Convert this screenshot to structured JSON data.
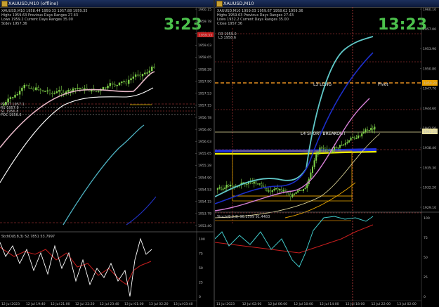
{
  "left": {
    "title": "XAUUSD,M10 (offline)",
    "header": [
      "XAUUSD,M10  1958.44 1959.33 1957.88 1959.35",
      "Highs 1959.63   Previous Days Ranges 27.43",
      "Lows 1959.2    Current Days Ranges 35.00",
      "Stdev 1957.36"
    ],
    "clock": "3:23",
    "price_labels": [
      "1960.15",
      "1959.78",
      "1959.40",
      "1959.03",
      "1958.65",
      "1958.28",
      "1957.90",
      "1957.53",
      "1957.15",
      "1956.78",
      "1956.40",
      "1956.03",
      "1955.65",
      "1955.28",
      "1954.90",
      "1954.53",
      "1954.15",
      "1953.78",
      "1953.40"
    ],
    "current_price": "1959.33",
    "mini_labels": [
      "PIVOT 1957.1",
      "R1 1957.0",
      "S1 1956.8",
      "POC 1956.6"
    ],
    "indicator_header": "StchD(8,8,3) 52.7851 53.7997",
    "indicator_levels": [
      "100",
      "75",
      "50",
      "25",
      "0"
    ],
    "time_labels": [
      "12 Jul 2023",
      "12 Jul 19:40",
      "12 Jul 21:00",
      "12 Jul 22:20",
      "12 Jul 23:40",
      "13 Jul 01:00",
      "13 Jul 02:20",
      "13 Jul 03:40"
    ]
  },
  "right": {
    "title": "XAUUSD,M10",
    "header": [
      "XAUUSD,M10  1959.03 1959.67 1958.62 1959.36",
      "Highs 1959.63   Previous Days Ranges 27.43",
      "Lows 1932.2    Current Days Ranges 35.00",
      "Close 1957.36"
    ],
    "clock": "13:23",
    "price_labels": [
      "1960.10",
      "1957.00",
      "1953.90",
      "1950.80",
      "1947.70",
      "1944.60",
      "1941.50",
      "1938.40",
      "1935.30",
      "1932.20",
      "1929.10"
    ],
    "line_labels": [
      "L3 LONG",
      "L4 SHORT BREAKOUT",
      "Pivot"
    ],
    "badges": [
      "1950.20",
      "1942.20"
    ],
    "mini_labels": [
      "R3 1959.0",
      "L3 1958.6"
    ],
    "indicator_header": "Stoch(8,3,3) 96.1599 91.4483",
    "indicator_levels": [
      "100",
      "75",
      "50",
      "25",
      "0"
    ],
    "time_labels": [
      "11 Jul 2023",
      "12 Jul 02:00",
      "12 Jul 06:00",
      "12 Jul 10:00",
      "12 Jul 14:00",
      "12 Jul 18:00",
      "12 Jul 22:00",
      "13 Jul 02:00"
    ]
  },
  "colors": {
    "candle": "#7fd24a",
    "clock": "#4cc24c",
    "bg": "#000000"
  }
}
